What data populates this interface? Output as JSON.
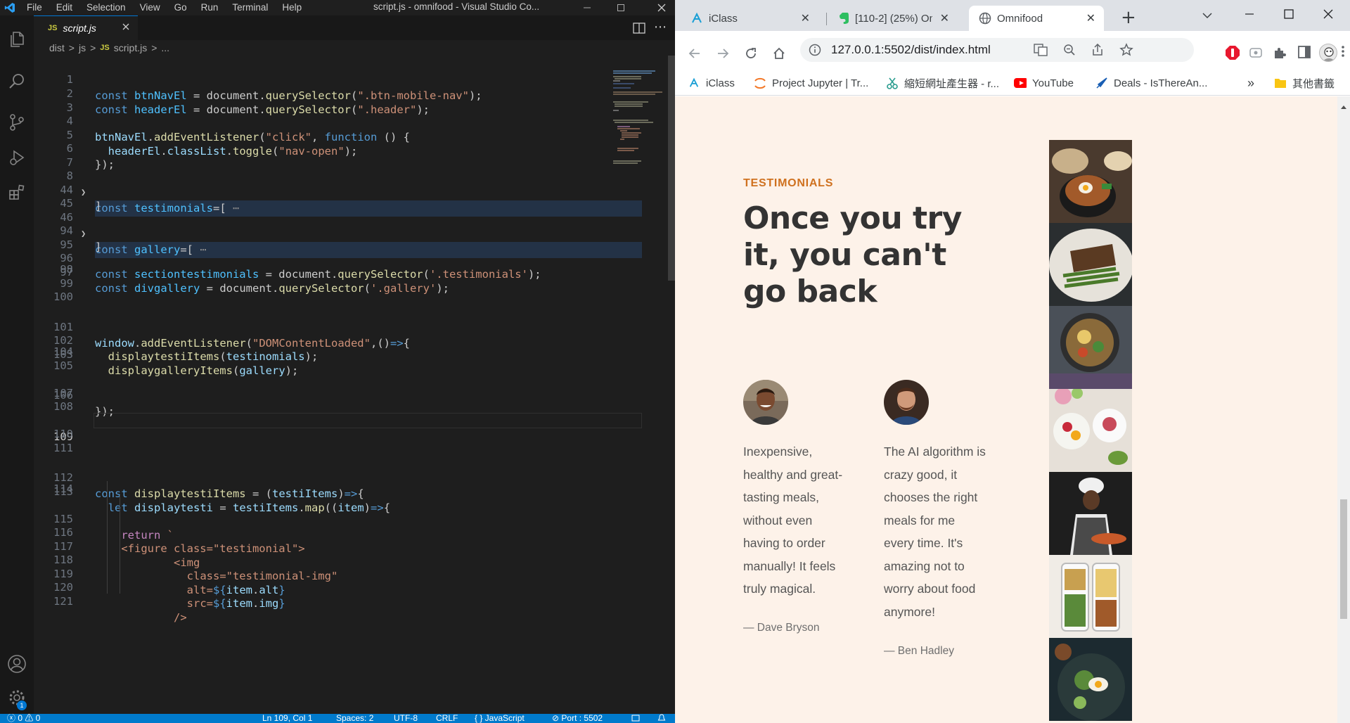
{
  "vscode": {
    "window_title": "script.js - omnifood - Visual Studio Co...",
    "menu": [
      "File",
      "Edit",
      "Selection",
      "View",
      "Go",
      "Run",
      "Terminal",
      "Help"
    ],
    "tab_label": "script.js",
    "tab_icon": "JS",
    "breadcrumb": [
      "dist",
      ">",
      "js",
      ">",
      "JS",
      "script.js",
      ">",
      "..."
    ],
    "settings_badge": "1",
    "accent": "#007acc",
    "status": {
      "problems": "ⓧ 0 ⚠ 0",
      "position": "Ln 109, Col 1",
      "spaces": "Spaces: 2",
      "encoding": "UTF-8",
      "eol": "CRLF",
      "language": "{ } JavaScript",
      "port": "⊘ Port : 5502"
    }
  },
  "code": {
    "line_numbers": [
      "1",
      "2",
      "3",
      "4",
      "5",
      "6",
      "7",
      "8",
      "44",
      "45",
      "46",
      "94",
      "95",
      "96",
      "97",
      "98",
      "99",
      "100",
      "101",
      "102",
      "103",
      "104",
      "105",
      "106",
      "107",
      "108",
      "109",
      "110",
      "111",
      "112",
      "113",
      "114",
      "115",
      "116",
      "117",
      "118",
      "119",
      "120",
      "121"
    ],
    "l1": [
      "const",
      " btnNavEl",
      " = document.",
      "querySelector",
      "(",
      "\".btn-mobile-nav\"",
      ");"
    ],
    "l2": [
      "const",
      " headerEl",
      " = document.",
      "querySelector",
      "(",
      "\".header\"",
      ");"
    ],
    "l4": [
      "btnNavEl",
      ".",
      "addEventListener",
      "(",
      "\"click\"",
      ", ",
      "function",
      " () {"
    ],
    "l5": [
      "  headerEl",
      ".",
      "classList",
      ".",
      "toggle",
      "(",
      "\"nav-open\"",
      ");"
    ],
    "l6": [
      "});"
    ],
    "l8": [
      "const",
      " testimonials",
      "=[",
      " ⋯"
    ],
    "l44": [
      "]"
    ],
    "l46": [
      "const",
      " gallery",
      "=[",
      " ⋯"
    ],
    "l94": [
      "]"
    ],
    "l96": [
      "const",
      " sectiontestimonials",
      " = document.",
      "querySelector",
      "(",
      "'.testimonials'",
      ");"
    ],
    "l97": [
      "const",
      " divgallery",
      " = document.",
      "querySelector",
      "(",
      "'.gallery'",
      ");"
    ],
    "l101": [
      "window",
      ".",
      "addEventListener",
      "(",
      "\"DOMContentLoaded\"",
      ",()",
      "=>",
      "{"
    ],
    "l102": [
      "  ",
      "displaytestiItems",
      "(",
      "testinomials",
      ");"
    ],
    "l103": [
      "  ",
      "displaygalleryItems",
      "(",
      "gallery",
      ");"
    ],
    "l106": [
      "});"
    ],
    "l112": [
      "const",
      " displaytestiItems",
      " = (",
      "testiItems",
      ")",
      "=>",
      "{"
    ],
    "l113": [
      "  ",
      "let",
      " displaytesti",
      " = ",
      "testiItems",
      ".",
      "map",
      "((",
      "item",
      ")",
      "=>",
      "{"
    ],
    "l115": [
      "    ",
      "return",
      " `"
    ],
    "l116": [
      "    ",
      "<figure class=\"testimonial\">"
    ],
    "l117": [
      "            ",
      "<img"
    ],
    "l118": [
      "              ",
      "class=\"testimonial-img\""
    ],
    "l119": [
      "              ",
      "alt=",
      "${",
      "item",
      ".",
      "alt",
      "}"
    ],
    "l120": [
      "              ",
      "src=",
      "${",
      "item",
      ".",
      "img",
      "}"
    ],
    "l121": [
      "            ",
      "/>"
    ]
  },
  "browser": {
    "tabs": [
      {
        "label": "iClass",
        "close": "✕"
      },
      {
        "label": "[110-2] (25%) Om",
        "close": "✕"
      },
      {
        "label": "Omnifood",
        "close": "✕"
      }
    ],
    "new_tab": "+",
    "url": "127.0.0.1:5502/dist/index.html",
    "bookmarks": [
      "iClass",
      "Project Jupyter | Tr...",
      "縮短網址產生器 - r...",
      "YouTube",
      "Deals - IsThereAn...",
      "»",
      "其他書籤"
    ]
  },
  "page": {
    "subheading": "TESTIMONIALS",
    "heading": "Once you try it, you can't go back",
    "testimonials": [
      {
        "quote": "Inexpensive, healthy and great-tasting meals, without even having to order manually! It feels truly magical.",
        "author": "— Dave Bryson"
      },
      {
        "quote": "The AI algorithm is crazy good, it chooses the right meals for me every time. It's amazing not to worry about food anymore!",
        "author": "— Ben Hadley"
      }
    ],
    "colors": {
      "background": "#fdf2e9",
      "accent": "#cf711f",
      "heading": "#333333"
    }
  }
}
